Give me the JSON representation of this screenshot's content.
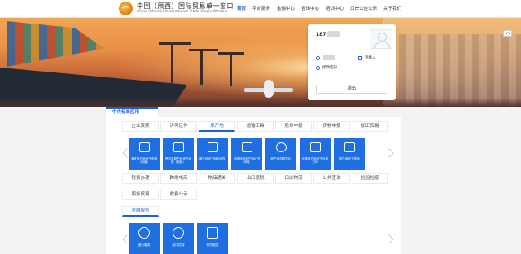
{
  "header": {
    "brand_title": "中国（辰西）国际贸易单一窗口",
    "brand_sub": "China (Shanxi) International Trade Single Window",
    "nav": [
      "首页",
      "平台服务",
      "金融中心",
      "咨询中心",
      "培训中心",
      "口岸公告公示",
      "关于我们"
    ],
    "nav_active_index": 0
  },
  "login": {
    "phone_prefix": "187",
    "role_label": "查找人",
    "password_label": "修改密码",
    "logout_label": "退出"
  },
  "section": {
    "title": "中央标准应用"
  },
  "tabs_row1": [
    "企业资质",
    "许可证件",
    "原产地",
    "运输工具",
    "舱单申报",
    "货物申报",
    "加工贸易"
  ],
  "tabs_row1_active_index": 2,
  "tiles_row1": [
    {
      "label": "海关原产地证书申报（新版）",
      "icon": "users-icon"
    },
    {
      "label": "贸促会原产地证书申报（新版）",
      "icon": "certificate-icon"
    },
    {
      "label": "原产地证书综合服务",
      "icon": "printer-icon"
    },
    {
      "label": "检验检疫原产地证书申报",
      "icon": "document-icon"
    },
    {
      "label": "原产地自助打印",
      "icon": "globe-icon"
    },
    {
      "label": "优惠原产地证书自助打印",
      "icon": "card-icon"
    },
    {
      "label": "原产地证书查询",
      "icon": "search-doc-icon"
    }
  ],
  "tabs_row2": [
    "税费办理",
    "跨境电商",
    "物品通关",
    "出口退税",
    "口岸物流",
    "公共查询",
    "检验检疫"
  ],
  "tabs_row3": [
    "服务贸易",
    "收费公示"
  ],
  "section2": {
    "title": "金融服务"
  },
  "tiles_row2": [
    {
      "label": "银行服务",
      "icon": "bank-icon"
    },
    {
      "label": "出口信保",
      "icon": "bank2-icon"
    },
    {
      "label": "保险服务",
      "icon": "ship-doc-icon"
    }
  ],
  "colors": {
    "accent": "#1f5fd6",
    "tile": "#1f6fe0"
  }
}
